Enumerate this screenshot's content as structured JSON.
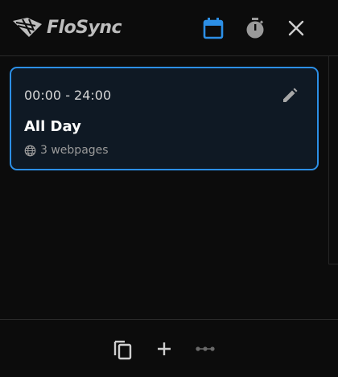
{
  "app": {
    "name": "FloSync"
  },
  "colors": {
    "accent": "#2c8fe6",
    "background": "#0c0c0c",
    "card": "#0f1924"
  },
  "header": {
    "icons": [
      "calendar-icon",
      "timer-icon",
      "close-icon"
    ]
  },
  "schedule": {
    "items": [
      {
        "time": "00:00 - 24:00",
        "title": "All Day",
        "meta": "3 webpages"
      }
    ]
  },
  "footer": {
    "icons": [
      "copy-icon",
      "add-icon",
      "more-icon"
    ]
  }
}
